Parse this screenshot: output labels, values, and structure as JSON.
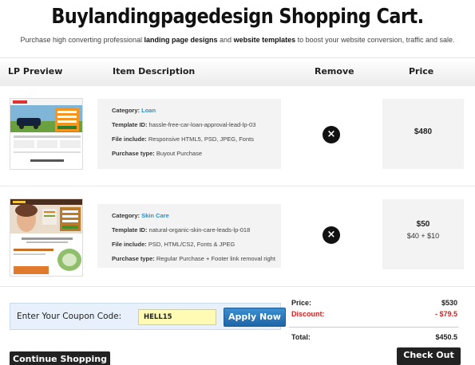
{
  "header": {
    "title": "Buylandingpagedesign Shopping Cart.",
    "subtitle_parts": [
      "Purchase high converting professional ",
      "landing page designs",
      " and ",
      "website templates",
      " to boost your website conversion, traffic and sale."
    ]
  },
  "table": {
    "columns": [
      "LP Preview",
      "Item Description",
      "Remove",
      "Price"
    ]
  },
  "items": [
    {
      "category_label": "Category:",
      "category": "Loan",
      "template_label": "Template ID:",
      "template_id": "hassle-free-car-loan-approval-lead-lp-03",
      "files_label": "File include:",
      "files": "Responsive HTML5, PSD, JPEG, Fonts",
      "purchase_label": "Purchase type:",
      "purchase_type": "Buyout Purchase",
      "price": "$480",
      "price_detail": "",
      "remove_icon": "close-icon"
    },
    {
      "category_label": "Category:",
      "category": "Skin Care",
      "template_label": "Template ID:",
      "template_id": "natural-organic-skin-care-leads-lp-018",
      "files_label": "File include:",
      "files": "PSD, HTML/CS2, Fonts & JPEG",
      "purchase_label": "Purchase type:",
      "purchase_type": "Regular Purchase + Footer link removal right",
      "price": "$50",
      "price_detail": "$40 + $10",
      "remove_icon": "close-icon"
    }
  ],
  "coupon": {
    "label": "Enter Your Coupon Code:",
    "value": "HELL15",
    "apply_label": "Apply Now"
  },
  "summary": {
    "price_label": "Price:",
    "price": "$530",
    "discount_label": "Discount:",
    "discount": "- $79.5",
    "total_label": "Total:",
    "total": "$450.5"
  },
  "actions": {
    "continue_label": "Continue Shopping",
    "checkout_label": "Check Out"
  },
  "colors": {
    "link_blue": "#2e8fc5",
    "discount_red": "#d42020",
    "apply_blue": "#1e66a8",
    "coupon_yellow": "#fffbb5"
  }
}
